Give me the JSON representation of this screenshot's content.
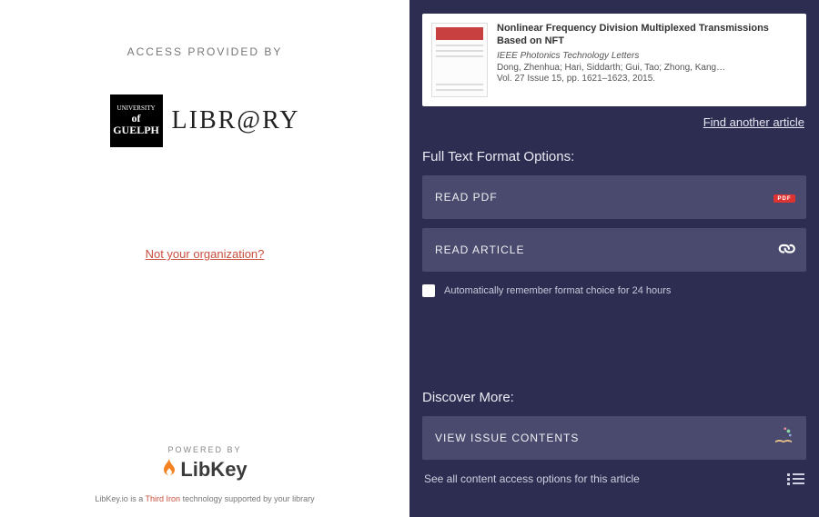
{
  "left": {
    "access_label": "ACCESS PROVIDED BY",
    "org_logo_alt": "University of Guelph Library",
    "org_library_word": "LIBR@RY",
    "org_guelph_top": "UNIVERSITY",
    "org_guelph_bottom": "of GUELPH",
    "not_your_org": "Not your organization?",
    "powered_by": "POWERED BY",
    "libkey_word": "LibKey",
    "footer": {
      "prefix": "LibKey.io is a ",
      "third_iron": "Third Iron",
      "suffix": " technology supported by your library"
    }
  },
  "right": {
    "article": {
      "title": "Nonlinear Frequency Division Multiplexed Transmissions Based on NFT",
      "journal": "IEEE Photonics Technology Letters",
      "authors": "Dong, Zhenhua; Hari, Siddarth; Gui, Tao; Zhong, Kang…",
      "citation": "Vol. 27 Issue 15, pp. 1621–1623, 2015."
    },
    "find_another": "Find another article",
    "fulltext_title": "Full Text Format Options:",
    "read_pdf": "READ PDF",
    "pdf_tag": "PDF",
    "read_article": "READ ARTICLE",
    "remember_label": "Automatically remember format choice for 24 hours",
    "discover_title": "Discover More:",
    "view_issue": "VIEW ISSUE CONTENTS",
    "see_all": "See all content access options for this article"
  }
}
